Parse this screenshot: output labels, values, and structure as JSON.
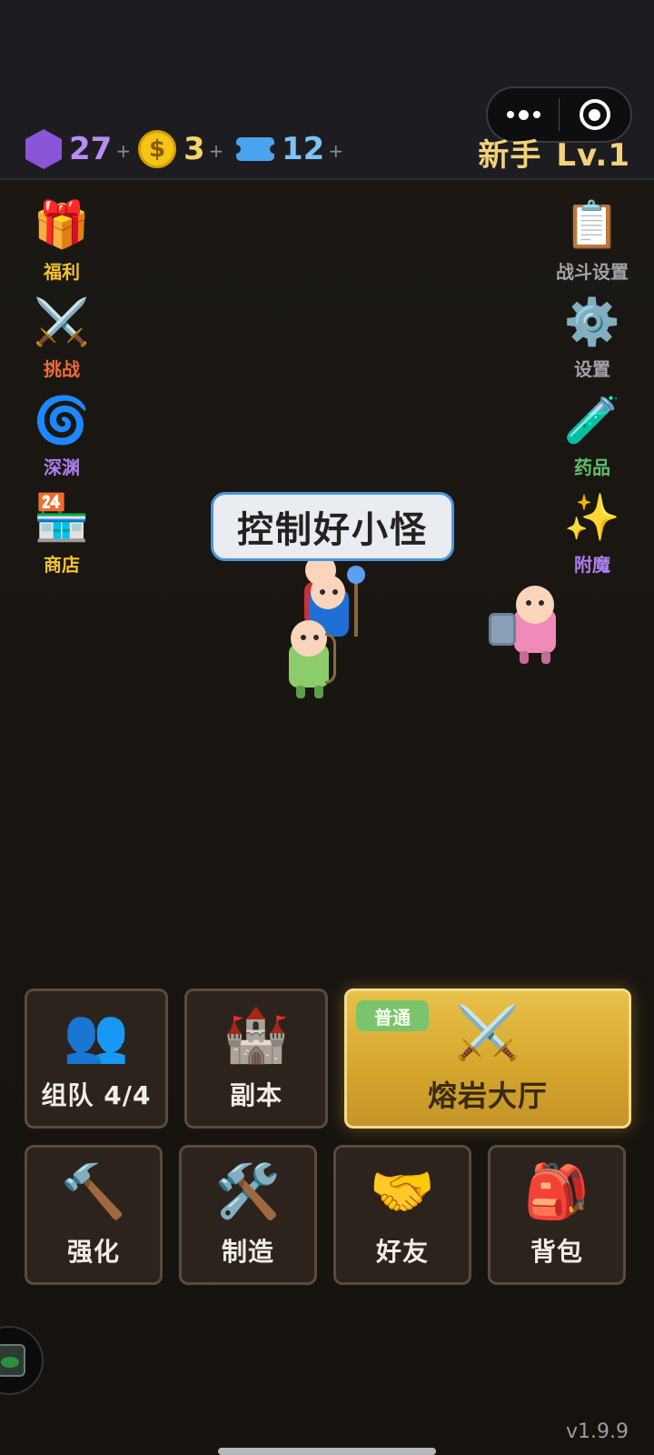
{
  "currencies": {
    "gems": "27",
    "coins": "3",
    "coin_symbol": "$",
    "tickets": "12",
    "plus": "+"
  },
  "player": {
    "rank": "新手",
    "level": "Lv.1"
  },
  "left_menu": [
    {
      "label": "福利",
      "icon": "gift-icon",
      "color": "#f2c230"
    },
    {
      "label": "挑战",
      "icon": "crossed-swords-icon",
      "color": "#ef6a3a"
    },
    {
      "label": "深渊",
      "icon": "swirl-icon",
      "color": "#b07ef0"
    },
    {
      "label": "商店",
      "icon": "shop-icon",
      "color": "#f2c230"
    }
  ],
  "right_menu": [
    {
      "label": "战斗设置",
      "icon": "clipboard-icon",
      "color": "#a3a3a8"
    },
    {
      "label": "设置",
      "icon": "gear-icon",
      "color": "#a3a3a8"
    },
    {
      "label": "药品",
      "icon": "test-tube-icon",
      "color": "#5fbf6e"
    },
    {
      "label": "附魔",
      "icon": "sparkles-icon",
      "color": "#b07ef0"
    }
  ],
  "bubble": "控制好小怪",
  "actions_top": [
    {
      "label": "组队 4/4",
      "icon": "team-icon"
    },
    {
      "label": "副本",
      "icon": "castle-icon"
    },
    {
      "label": "熔岩大厅",
      "icon": "crossed-swords-icon",
      "tag": "普通"
    }
  ],
  "actions_bottom": [
    {
      "label": "强化",
      "icon": "hammer-icon"
    },
    {
      "label": "制造",
      "icon": "tools-icon"
    },
    {
      "label": "好友",
      "icon": "handshake-icon"
    },
    {
      "label": "背包",
      "icon": "backpack-icon"
    }
  ],
  "version": "v1.9.9",
  "colors": {
    "gem": "#8a55d6",
    "coin": "#f4c416",
    "ticket": "#4aa3ee",
    "rank": "#f2d27a",
    "gold_card": "#d4a52c",
    "tag": "#7bc46b"
  }
}
